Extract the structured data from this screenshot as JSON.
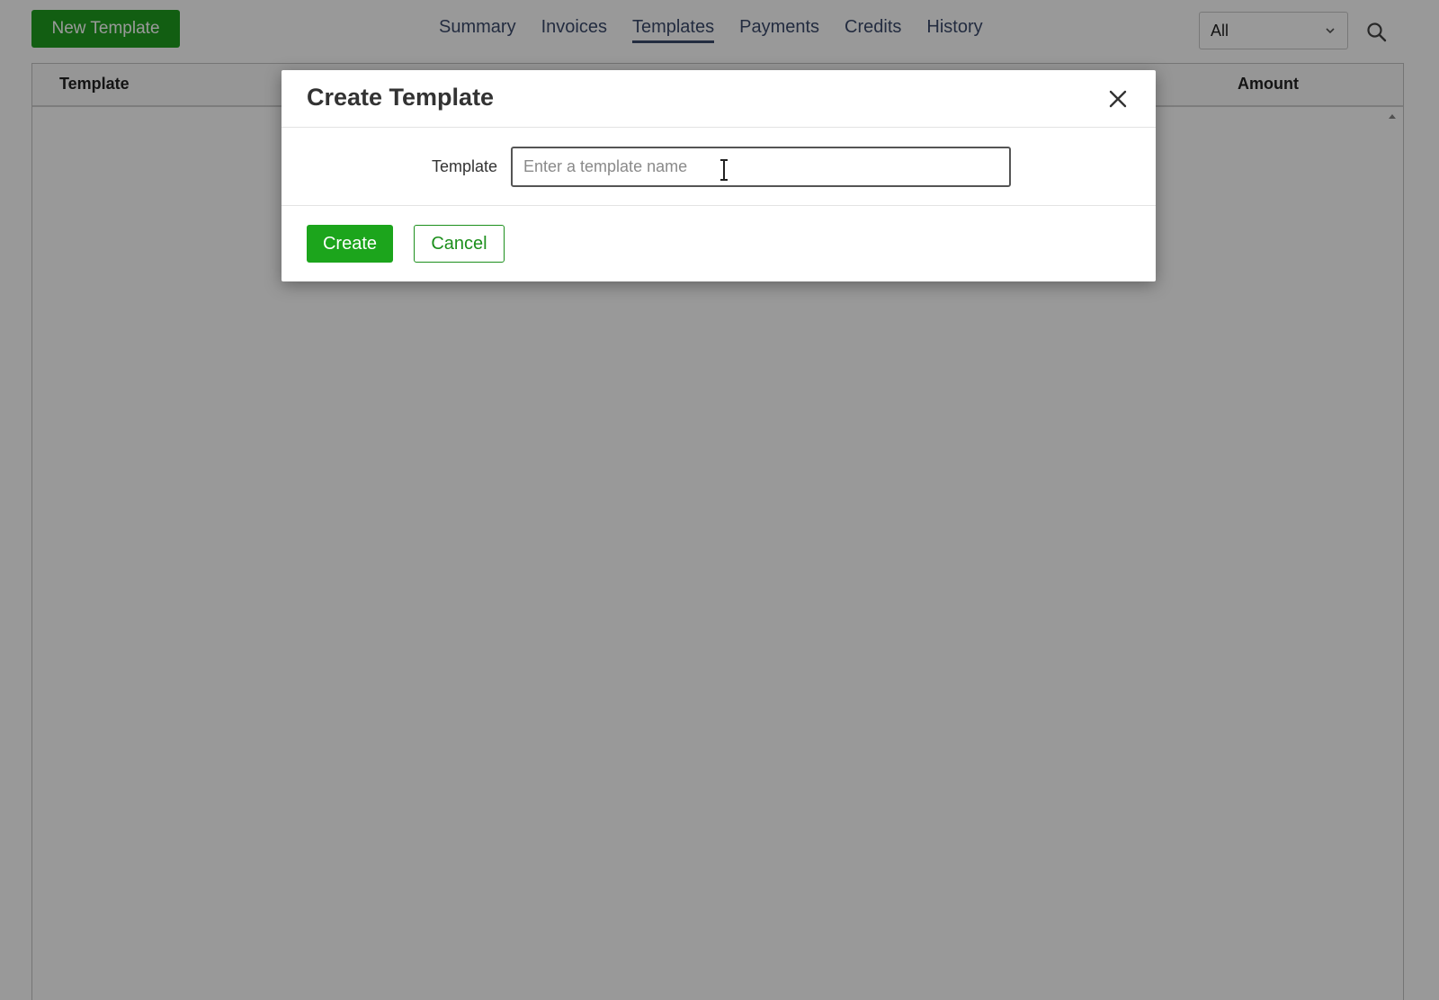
{
  "toolbar": {
    "new_template_label": "New Template",
    "filter_value": "All",
    "search_icon": "search-icon"
  },
  "nav": {
    "tabs": [
      {
        "label": "Summary",
        "active": false
      },
      {
        "label": "Invoices",
        "active": false
      },
      {
        "label": "Templates",
        "active": true
      },
      {
        "label": "Payments",
        "active": false
      },
      {
        "label": "Credits",
        "active": false
      },
      {
        "label": "History",
        "active": false
      }
    ]
  },
  "table": {
    "columns": [
      "Template",
      "Amount"
    ],
    "rows": []
  },
  "modal": {
    "title": "Create Template",
    "close_icon": "close-icon",
    "field_label": "Template",
    "field_placeholder": "Enter a template name",
    "field_value": "",
    "create_label": "Create",
    "cancel_label": "Cancel"
  },
  "colors": {
    "primary_green": "#1ca51c",
    "nav_text": "#3b4a6b"
  }
}
